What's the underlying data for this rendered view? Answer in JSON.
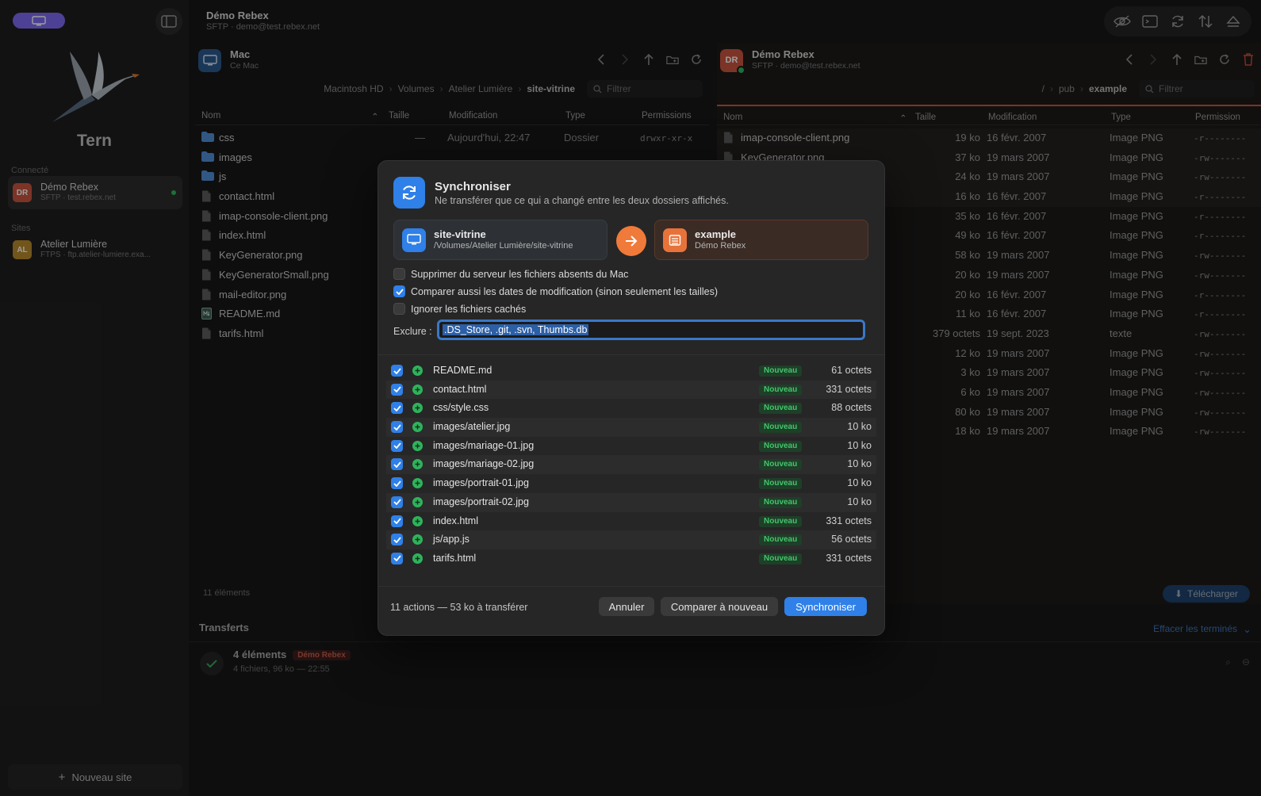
{
  "sidebar": {
    "app_name": "Tern",
    "section_connected": "Connecté",
    "connected": [
      {
        "initials": "DR",
        "name": "Démo Rebex",
        "sub": "SFTP · test.rebex.net",
        "color": "#c9553f"
      }
    ],
    "section_sites": "Sites",
    "sites": [
      {
        "initials": "AL",
        "name": "Atelier Lumière",
        "sub": "FTPS · ftp.atelier-lumiere.exa...",
        "color": "#b78a2a"
      }
    ],
    "new_site": "Nouveau site"
  },
  "window": {
    "title": "Démo Rebex",
    "subtitle": "SFTP · demo@test.rebex.net"
  },
  "left_pane": {
    "title": "Mac",
    "subtitle": "Ce Mac",
    "breadcrumbs": [
      "Macintosh HD",
      "Volumes",
      "Atelier Lumière",
      "site-vitrine"
    ],
    "filter_placeholder": "Filtrer",
    "columns": [
      "Nom",
      "Taille",
      "Modification",
      "Type",
      "Permissions"
    ],
    "rows": [
      {
        "name": "css",
        "kind": "folder",
        "size": "—",
        "date": "Aujourd'hui, 22:47",
        "type": "Dossier",
        "perm": "drwxr-xr-x"
      },
      {
        "name": "images",
        "kind": "folder",
        "size": "",
        "date": "",
        "type": "",
        "perm": ""
      },
      {
        "name": "js",
        "kind": "folder",
        "size": "",
        "date": "",
        "type": "",
        "perm": ""
      },
      {
        "name": "contact.html",
        "kind": "file",
        "size": "",
        "date": "",
        "type": "",
        "perm": ""
      },
      {
        "name": "imap-console-client.png",
        "kind": "file",
        "size": "",
        "date": "",
        "type": "",
        "perm": ""
      },
      {
        "name": "index.html",
        "kind": "file",
        "size": "",
        "date": "",
        "type": "",
        "perm": ""
      },
      {
        "name": "KeyGenerator.png",
        "kind": "file",
        "size": "",
        "date": "",
        "type": "",
        "perm": ""
      },
      {
        "name": "KeyGeneratorSmall.png",
        "kind": "file",
        "size": "",
        "date": "",
        "type": "",
        "perm": ""
      },
      {
        "name": "mail-editor.png",
        "kind": "file",
        "size": "",
        "date": "",
        "type": "",
        "perm": ""
      },
      {
        "name": "README.md",
        "kind": "md",
        "size": "",
        "date": "",
        "type": "",
        "perm": ""
      },
      {
        "name": "tarifs.html",
        "kind": "file",
        "size": "",
        "date": "",
        "type": "",
        "perm": ""
      }
    ],
    "status": "11 éléments"
  },
  "right_pane": {
    "title": "Démo Rebex",
    "subtitle": "SFTP · demo@test.rebex.net",
    "initials": "DR",
    "breadcrumbs": [
      "/",
      "pub",
      "example"
    ],
    "filter_placeholder": "Filtrer",
    "columns": [
      "Nom",
      "Taille",
      "Modification",
      "Type",
      "Permission"
    ],
    "rows": [
      {
        "name": "imap-console-client.png",
        "size": "19 ko",
        "date": "16 févr. 2007",
        "type": "Image PNG",
        "perm": "-r--------"
      },
      {
        "name": "KeyGenerator.png",
        "size": "37 ko",
        "date": "19 mars 2007",
        "type": "Image PNG",
        "perm": "-rw-------"
      },
      {
        "name": "",
        "size": "24 ko",
        "date": "19 mars 2007",
        "type": "Image PNG",
        "perm": "-rw-------"
      },
      {
        "name": "",
        "size": "16 ko",
        "date": "16 févr. 2007",
        "type": "Image PNG",
        "perm": "-r--------"
      },
      {
        "name": "",
        "size": "35 ko",
        "date": "16 févr. 2007",
        "type": "Image PNG",
        "perm": "-r--------"
      },
      {
        "name": "",
        "size": "49 ko",
        "date": "16 févr. 2007",
        "type": "Image PNG",
        "perm": "-r--------"
      },
      {
        "name": "",
        "size": "58 ko",
        "date": "19 mars 2007",
        "type": "Image PNG",
        "perm": "-rw-------"
      },
      {
        "name": "",
        "size": "20 ko",
        "date": "19 mars 2007",
        "type": "Image PNG",
        "perm": "-rw-------"
      },
      {
        "name": "",
        "size": "20 ko",
        "date": "16 févr. 2007",
        "type": "Image PNG",
        "perm": "-r--------"
      },
      {
        "name": "",
        "size": "11 ko",
        "date": "16 févr. 2007",
        "type": "Image PNG",
        "perm": "-r--------"
      },
      {
        "name": "",
        "size": "379 octets",
        "date": "19 sept. 2023",
        "type": "texte",
        "perm": "-rw-------"
      },
      {
        "name": "",
        "size": "12 ko",
        "date": "19 mars 2007",
        "type": "Image PNG",
        "perm": "-rw-------"
      },
      {
        "name": "",
        "size": "3 ko",
        "date": "19 mars 2007",
        "type": "Image PNG",
        "perm": "-rw-------"
      },
      {
        "name": "",
        "size": "6 ko",
        "date": "19 mars 2007",
        "type": "Image PNG",
        "perm": "-rw-------"
      },
      {
        "name": "",
        "size": "80 ko",
        "date": "19 mars 2007",
        "type": "Image PNG",
        "perm": "-rw-------"
      },
      {
        "name": "",
        "size": "18 ko",
        "date": "19 mars 2007",
        "type": "Image PNG",
        "perm": "-rw-------"
      }
    ],
    "download_label": "Télécharger"
  },
  "transfers": {
    "title": "Transferts",
    "clear_label": "Effacer les terminés",
    "item": {
      "title": "4 éléments",
      "badge": "Démo Rebex",
      "sub": "4 fichiers, 96 ko — 22:55"
    }
  },
  "dialog": {
    "title": "Synchroniser",
    "subtitle": "Ne transférer que ce qui a changé entre les deux dossiers affichés.",
    "source": {
      "name": "site-vitrine",
      "path": "/Volumes/Atelier Lumière/site-vitrine"
    },
    "dest": {
      "name": "example",
      "path": "Démo Rebex"
    },
    "options": [
      {
        "label": "Supprimer du serveur les fichiers absents du Mac",
        "checked": false
      },
      {
        "label": "Comparer aussi les dates de modification (sinon seulement les tailles)",
        "checked": true
      },
      {
        "label": "Ignorer les fichiers cachés",
        "checked": false
      }
    ],
    "exclude_label": "Exclure :",
    "exclude_value": ".DS_Store, .git, .svn, Thumbs.db",
    "files": [
      {
        "name": "README.md",
        "badge": "Nouveau",
        "size": "61 octets"
      },
      {
        "name": "contact.html",
        "badge": "Nouveau",
        "size": "331 octets"
      },
      {
        "name": "css/style.css",
        "badge": "Nouveau",
        "size": "88 octets"
      },
      {
        "name": "images/atelier.jpg",
        "badge": "Nouveau",
        "size": "10 ko"
      },
      {
        "name": "images/mariage-01.jpg",
        "badge": "Nouveau",
        "size": "10 ko"
      },
      {
        "name": "images/mariage-02.jpg",
        "badge": "Nouveau",
        "size": "10 ko"
      },
      {
        "name": "images/portrait-01.jpg",
        "badge": "Nouveau",
        "size": "10 ko"
      },
      {
        "name": "images/portrait-02.jpg",
        "badge": "Nouveau",
        "size": "10 ko"
      },
      {
        "name": "index.html",
        "badge": "Nouveau",
        "size": "331 octets"
      },
      {
        "name": "js/app.js",
        "badge": "Nouveau",
        "size": "56 octets"
      },
      {
        "name": "tarifs.html",
        "badge": "Nouveau",
        "size": "331 octets"
      }
    ],
    "summary": "11 actions — 53 ko à transférer",
    "cancel": "Annuler",
    "compare_again": "Comparer à nouveau",
    "sync": "Synchroniser"
  }
}
